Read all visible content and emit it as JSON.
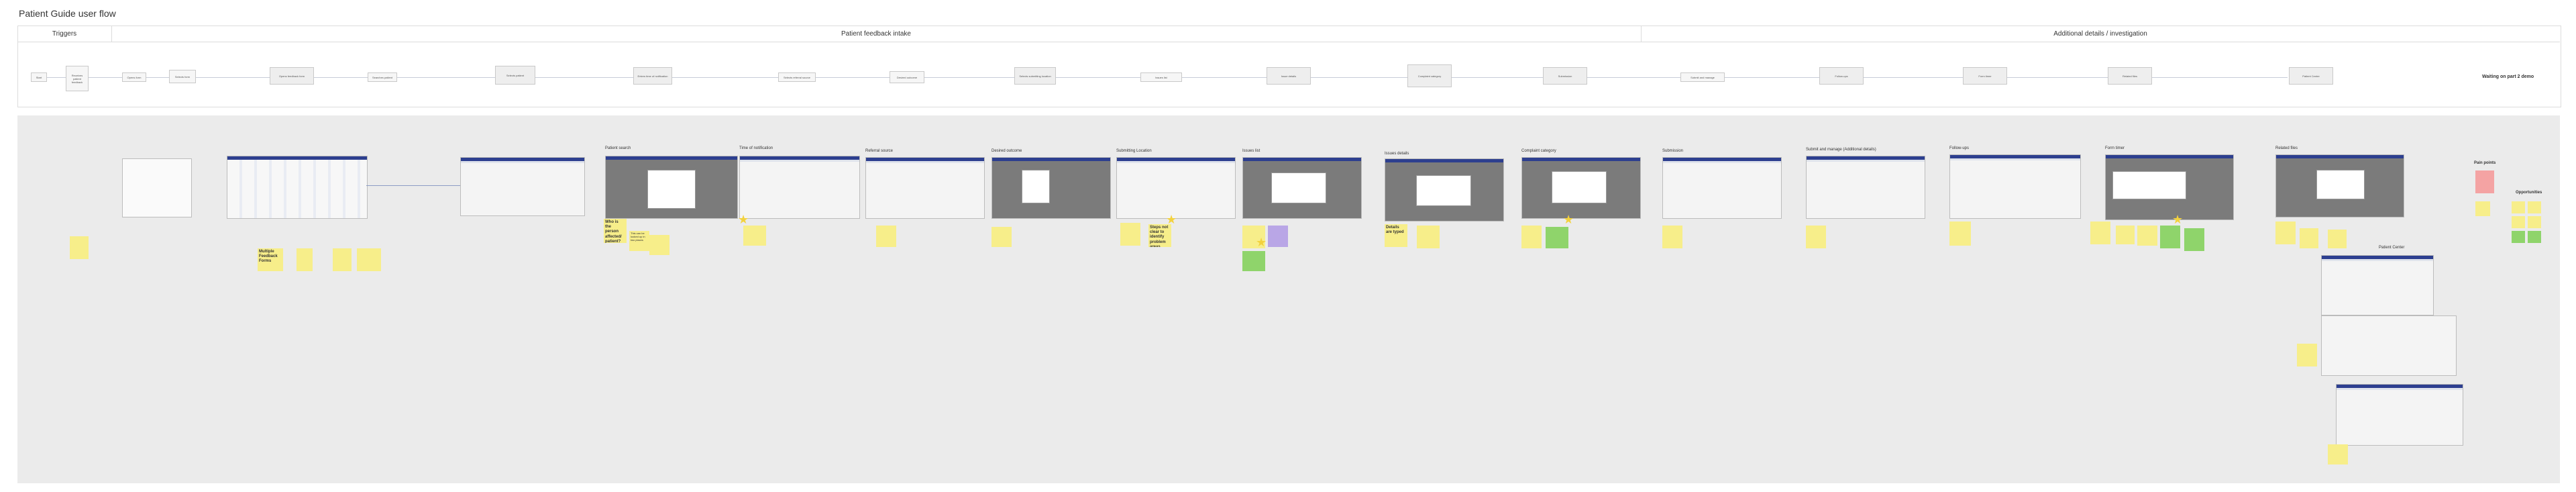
{
  "page": {
    "title": "Patient Guide user flow"
  },
  "sections": [
    {
      "label": "Triggers"
    },
    {
      "label": "Patient feedback intake"
    },
    {
      "label": "Additional details / investigation"
    }
  ],
  "flow_nodes": [
    "Start",
    "Receives patient feedback",
    "Opens form",
    "Selects form",
    "Opens feedback form",
    "Searches patient",
    "Selects patient",
    "Enters time of notification",
    "Selects referral source",
    "Desired outcome",
    "Selects submitting location",
    "Issues list",
    "Issue details",
    "Complaint category",
    "Submission",
    "Submit and manage",
    "Follow-ups",
    "Form timer",
    "Related files",
    "Patient Center"
  ],
  "waiting_note": "Waiting on part 2 demo",
  "screens": [
    {
      "label": "Patient search"
    },
    {
      "label": "Time of notification"
    },
    {
      "label": "Referral source"
    },
    {
      "label": "Desired outcome"
    },
    {
      "label": "Submitting Location"
    },
    {
      "label": "Issues list"
    },
    {
      "label": "Issues details"
    },
    {
      "label": "Complaint category"
    },
    {
      "label": "Submission"
    },
    {
      "label": "Submit and manage (Additional details)"
    },
    {
      "label": "Follow-ups"
    },
    {
      "label": "Form timer"
    },
    {
      "label": "Related files"
    },
    {
      "label": "Patient Center"
    }
  ],
  "stickies": {
    "multiple_feedback": "Multiple Feedback Forms",
    "who_affected": "Who is the person affected/ patient?",
    "can_be_tracked": "This can be looked up in two places",
    "steps_not_clear": "Steps not clear to identify problem areas",
    "details_typed": "Details are typed",
    "pain_points": "Pain points",
    "opportunities": "Opportunities"
  },
  "colors": {
    "sticky": "#f7ee8a",
    "green": "#8fd46b",
    "purple": "#b9a6e6",
    "pink": "#f4a3a3",
    "appbar": "#2d3f8f"
  }
}
